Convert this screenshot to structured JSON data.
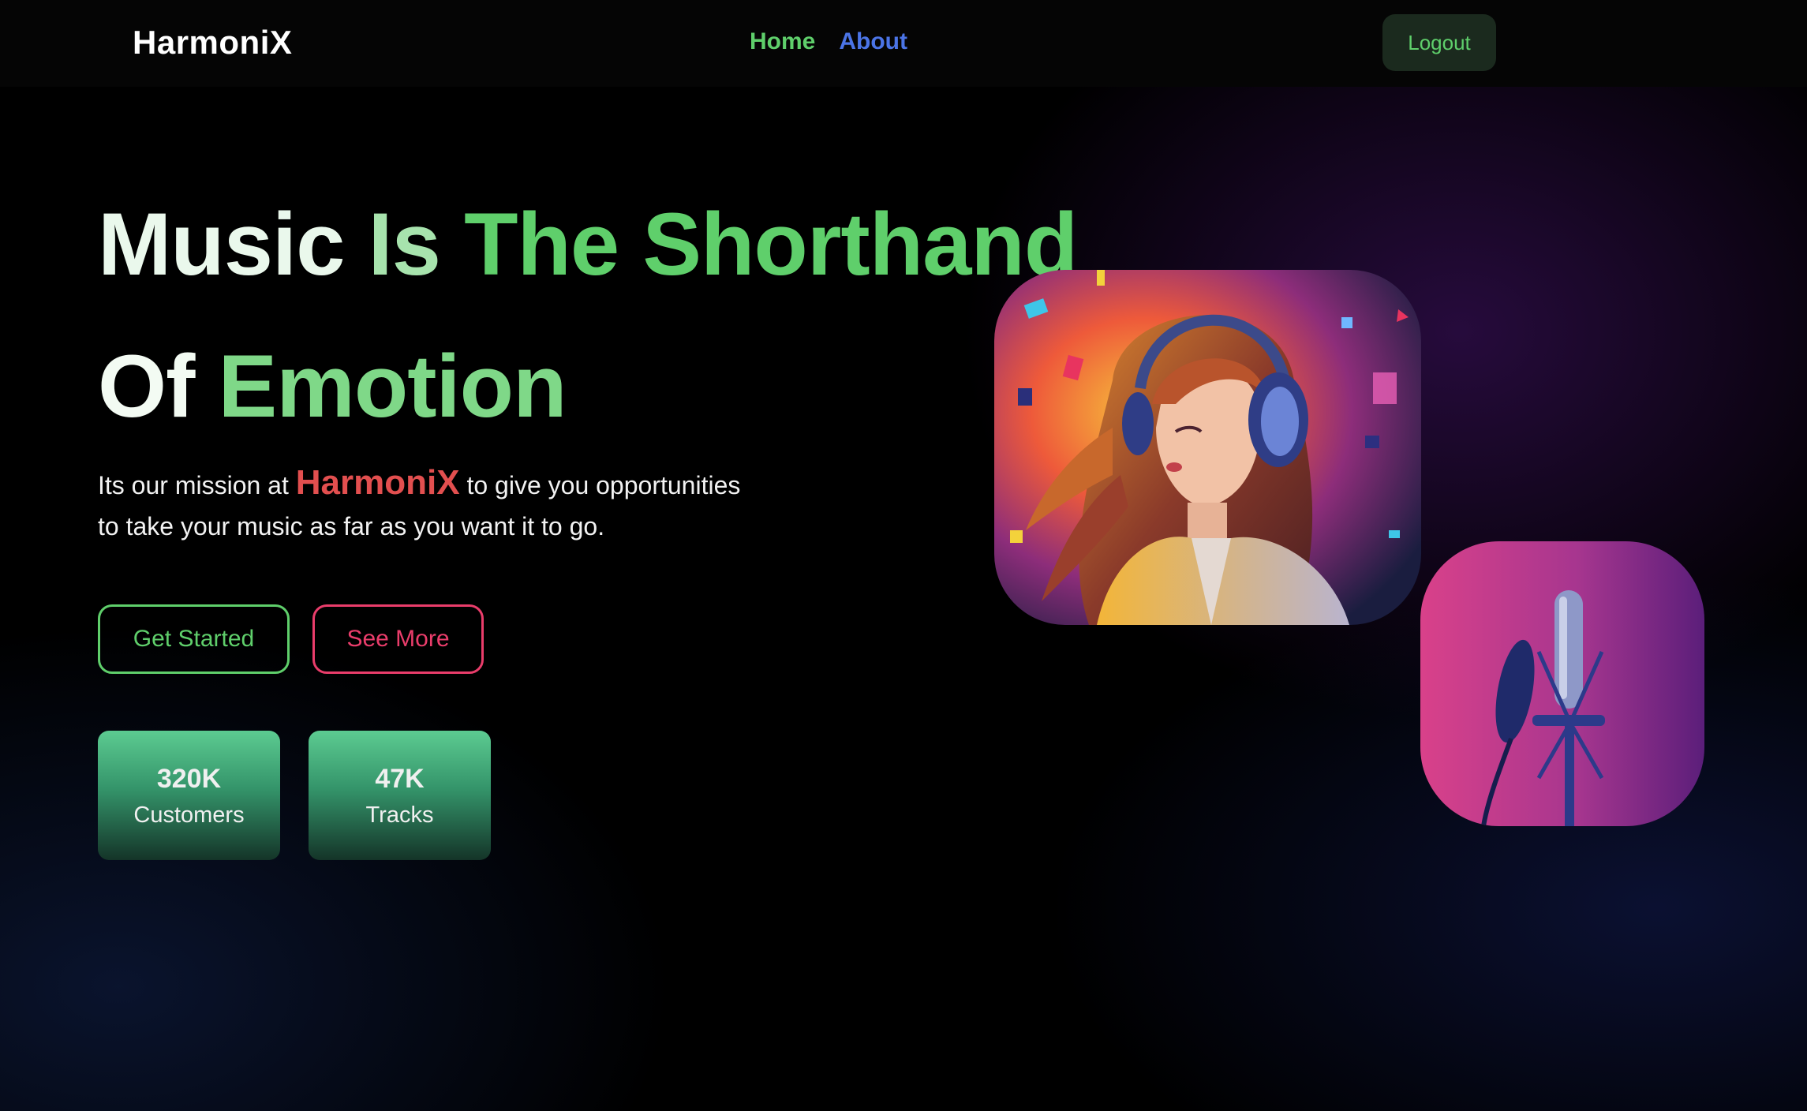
{
  "nav": {
    "brand": "HarmoniX",
    "links": [
      "Home",
      "About"
    ],
    "logout_label": "Logout"
  },
  "hero": {
    "headline_words": [
      "Music",
      "Is",
      "The",
      "Shorthand",
      "Of",
      "Emotion"
    ],
    "mission_prefix": "Its our mission at",
    "mission_brand": "HarmoniX",
    "mission_suffix_line1": "to give you opportunities",
    "mission_line2": "to take your music as far as you want it to go.",
    "buttons": {
      "get_started": "Get Started",
      "see_more": "See More"
    },
    "stats": [
      {
        "value": "320K",
        "label": "Customers"
      },
      {
        "value": "47K",
        "label": "Tracks"
      }
    ]
  },
  "images": {
    "main_art": "girl-with-headphones-illustration",
    "secondary_art": "studio-microphone-photo"
  },
  "colors": {
    "accent_green": "#5fcf6b",
    "accent_blue": "#4b74e6",
    "accent_red": "#e24f4f",
    "accent_pink": "#ea3d6b",
    "background": "#000000"
  }
}
